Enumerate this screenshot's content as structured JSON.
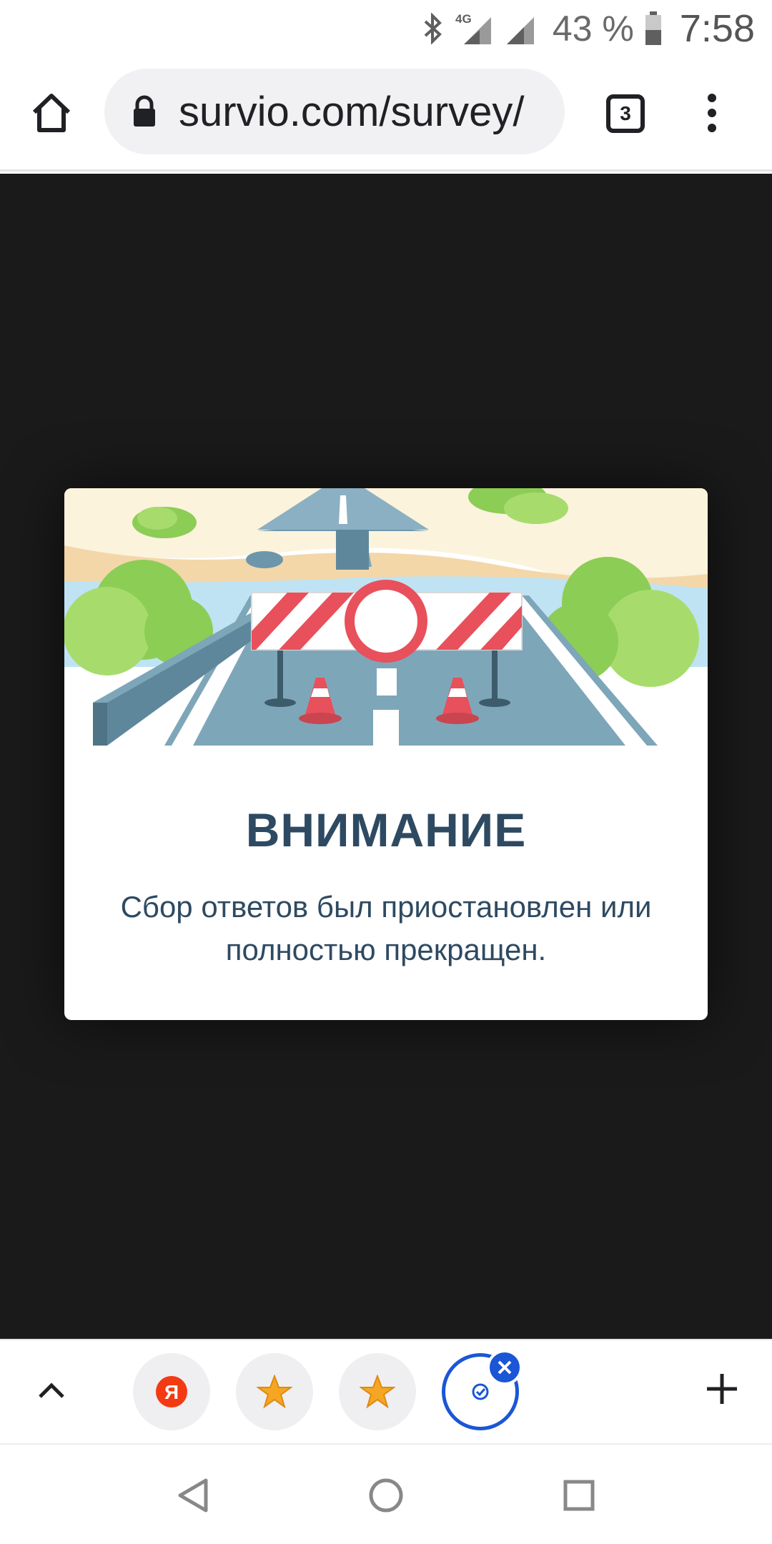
{
  "status_bar": {
    "battery_percent": "43 %",
    "time": "7:58",
    "network": "4G",
    "icons": [
      "bluetooth-icon",
      "signal-4g-icon",
      "signal-icon",
      "battery-icon"
    ]
  },
  "toolbar": {
    "url": "survio.com/survey/",
    "tab_count": "3",
    "icons": [
      "home-icon",
      "lock-icon",
      "tabs-icon",
      "more-vert-icon"
    ]
  },
  "modal": {
    "title": "ВНИМАНИЕ",
    "message": "Сбор ответов был приостановлен или полностью прекращен.",
    "illustration": "road-barrier-illustration"
  },
  "bottom_bar": {
    "chips": [
      {
        "name": "yandex-chip",
        "glyph": "Я",
        "color": "#f33a12"
      },
      {
        "name": "bookmark-chip-1",
        "glyph": "★",
        "color": "#f5a623"
      },
      {
        "name": "bookmark-chip-2",
        "glyph": "★",
        "color": "#f5a623"
      },
      {
        "name": "survio-chip",
        "active": true,
        "color": "#1a56d6"
      }
    ],
    "icons": [
      "chevron-up-icon",
      "plus-icon",
      "close-icon"
    ]
  },
  "colors": {
    "content_bg": "#1a1a1a",
    "title": "#2e4a62",
    "accent_blue": "#1a56d6"
  }
}
